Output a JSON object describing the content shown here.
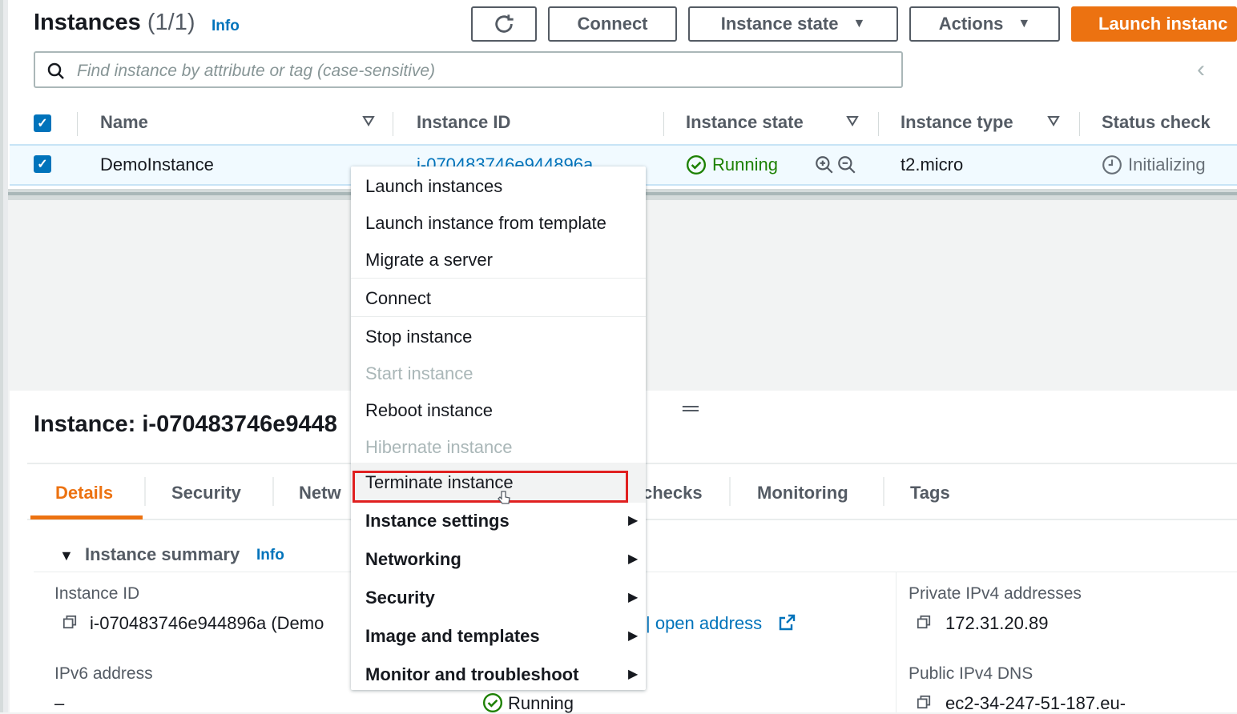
{
  "header": {
    "title": "Instances",
    "count": "(1/1)",
    "info": "Info",
    "buttons": {
      "refresh_icon": "refresh-icon",
      "connect": "Connect",
      "instance_state": "Instance state",
      "actions": "Actions",
      "launch": "Launch instanc"
    }
  },
  "search": {
    "placeholder": "Find instance by attribute or tag (case-sensitive)"
  },
  "table": {
    "columns": [
      "Name",
      "Instance ID",
      "Instance state",
      "Instance type",
      "Status check"
    ],
    "rows": [
      {
        "name": "DemoInstance",
        "instance_id": "i-070483746e944896a",
        "state": "Running",
        "type": "t2.micro",
        "status_check": "Initializing"
      }
    ]
  },
  "detail": {
    "title": "Instance: i-070483746e9448",
    "tabs": [
      "Details",
      "Security",
      "Netw",
      "checks",
      "Monitoring",
      "Tags"
    ],
    "active_tab": "Details",
    "summary": {
      "heading": "Instance summary",
      "info": "Info"
    },
    "fields": {
      "instance_id_label": "Instance ID",
      "instance_id_value": "i-070483746e944896a (Demo",
      "ipv6_label": "IPv6 address",
      "ipv6_value": "–",
      "open_address": "| open address",
      "private_ipv4_label": "Private IPv4 addresses",
      "private_ipv4_value": "172.31.20.89",
      "public_dns_label": "Public IPv4 DNS",
      "public_dns_value": "ec2-34-247-51-187.eu-",
      "state_value": "Running"
    }
  },
  "menu": {
    "items": [
      {
        "label": "Launch instances",
        "disabled": false
      },
      {
        "label": "Launch instance from template",
        "disabled": false
      },
      {
        "label": "Migrate a server",
        "disabled": false
      },
      {
        "label": "Connect",
        "disabled": false
      },
      {
        "label": "Stop instance",
        "disabled": false
      },
      {
        "label": "Start instance",
        "disabled": true
      },
      {
        "label": "Reboot instance",
        "disabled": false
      },
      {
        "label": "Hibernate instance",
        "disabled": true
      },
      {
        "label": "Terminate instance",
        "disabled": false,
        "highlighted": true
      },
      {
        "label": "Instance settings",
        "submenu": true
      },
      {
        "label": "Networking",
        "submenu": true
      },
      {
        "label": "Security",
        "submenu": true
      },
      {
        "label": "Image and templates",
        "submenu": true
      },
      {
        "label": "Monitor and troubleshoot",
        "submenu": true
      }
    ]
  },
  "colors": {
    "accent": "#ec7211",
    "link": "#0073bb",
    "running": "#1d8102",
    "highlight_box": "#e02020"
  }
}
